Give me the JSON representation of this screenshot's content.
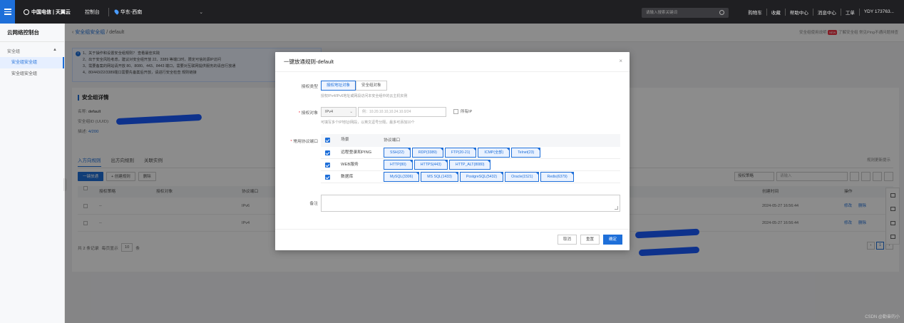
{
  "topbar": {
    "logo_text": "中国电信 | 天翼云",
    "console": "控制台",
    "region": "华东-西南",
    "search_placeholder": "请输入搜索关键词",
    "right_items": [
      "购物车",
      "收藏",
      "帮助中心",
      "消息中心",
      "工单",
      "YDY 173763..."
    ]
  },
  "sidenav": {
    "title": "云网络控制台",
    "group": "安全组",
    "items": [
      "安全组安全组",
      "安全组安全组"
    ]
  },
  "breadcrumb": {
    "parent": "安全组安全组",
    "current": "default"
  },
  "help_links": [
    "安全组使用说明",
    "了解安全组",
    "常见Ping不通问题排查"
  ],
  "help_badge": "NEW",
  "notice": {
    "lines": [
      "1、关于操作和设置安全组规则？ 查看最佳实践",
      "2、出于安全风险考虑，建议对安全组开放 22、3389 等端口时，限定可信的源IP访问",
      "3、需要备案的网站请开放 80、8080、443、8443 端口，需要对互联网提供服务的请自行放通",
      "4、80/443/22/3389端口需要先备案后开放，请进行安全检查 规则链接"
    ],
    "link": "查看最佳实践"
  },
  "info": {
    "heading": "安全组详情",
    "name_label": "名称:",
    "name_value": "default",
    "id_label": "安全组ID (UUID):",
    "vpc_label": "描述:",
    "rules_label": "规则数:",
    "rules_value": "4/200"
  },
  "rules": {
    "tabs": [
      "入方向规则",
      "出方向规则",
      "关联实例"
    ],
    "add_btn": "一键放通",
    "create_btn": "+ 创建规则",
    "delete_btn": "删除",
    "feedback": "规则更新提示",
    "filter_select": "授权策略",
    "filter_placeholder": "请输入",
    "headers": [
      "授权策略",
      "授权对象",
      "协议端口",
      "创建时间",
      "操作"
    ],
    "rows": [
      {
        "policy": "--",
        "ip": "IPv6",
        "time": "2024-05-27 16:56:44",
        "op1": "修改",
        "op2": "删除"
      },
      {
        "policy": "--",
        "ip": "IPv4",
        "time": "2024-05-27 16:56:44",
        "op1": "修改",
        "op2": "删除"
      }
    ],
    "pager_total": "共 2 条记录",
    "pager_size_label": "每页显示",
    "pager_size": "10",
    "pager_unit": "条",
    "page": "1"
  },
  "modal": {
    "title": "一键放通规则-default",
    "close": "×",
    "auth_type_label": "授权类型",
    "auth_type_options": [
      "授权地址对象",
      "安全组对象"
    ],
    "auth_type_hint": "授权IPv4/IPv6地址或网段访问本安全组中的云主机实例",
    "auth_obj_label": "授权对象",
    "ip_version": "IPv4",
    "ip_placeholder": "例：10.20.10.10,10.24.10.0/24",
    "all_ip": "所有IP",
    "ip_hint": "可填写多个IP地址/网段，以英文逗号分隔，最多可添加10个",
    "ports_label": "常用协议端口",
    "ports_header": [
      "场景",
      "协议端口"
    ],
    "port_rows": [
      {
        "scene": "远程登录和PING",
        "tags": [
          "SSH(22)",
          "RDP(3389)",
          "FTP(20-21)",
          "ICMP(全部)",
          "Telnet(23)"
        ]
      },
      {
        "scene": "WEB服务",
        "tags": [
          "HTTP(80)",
          "HTTPS(443)",
          "HTTP_ALT(8080)"
        ]
      },
      {
        "scene": "数据库",
        "tags": [
          "MySQL(3306)",
          "MS SQL(1433)",
          "PostgreSQL(5432)",
          "Oracle(1521)",
          "Redis(6379)"
        ]
      }
    ],
    "remark_label": "备注",
    "btn_cancel": "取消",
    "btn_reset": "重置",
    "btn_ok": "确定"
  },
  "watermark": "CSDN @勤奋的小"
}
